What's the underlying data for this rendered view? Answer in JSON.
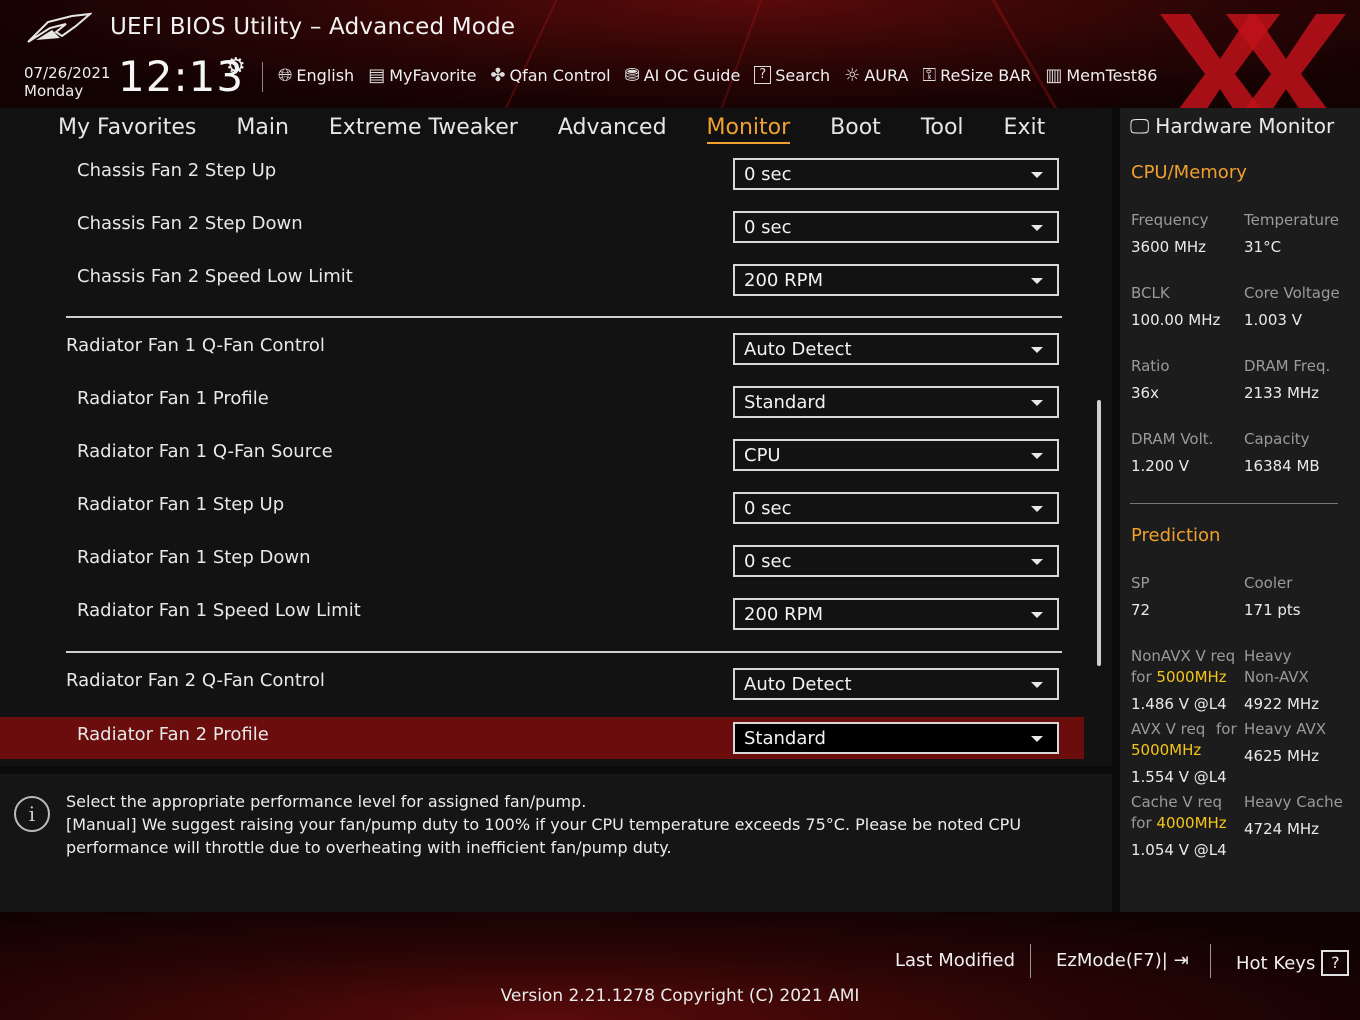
{
  "header": {
    "title": "UEFI BIOS Utility – Advanced Mode",
    "date": "07/26/2021",
    "day": "Monday",
    "time": "12:13",
    "toolbar": [
      {
        "label": "English",
        "icon": "globe-icon"
      },
      {
        "label": "MyFavorite",
        "icon": "favorite-icon"
      },
      {
        "label": "Qfan Control",
        "icon": "fan-icon"
      },
      {
        "label": "AI OC Guide",
        "icon": "ai-chip-icon"
      },
      {
        "label": "Search",
        "icon": "search-icon"
      },
      {
        "label": "AURA",
        "icon": "aura-light-icon"
      },
      {
        "label": "ReSize BAR",
        "icon": "resize-bar-icon"
      },
      {
        "label": "MemTest86",
        "icon": "memory-icon"
      }
    ]
  },
  "nav": {
    "tabs": [
      "My Favorites",
      "Main",
      "Extreme Tweaker",
      "Advanced",
      "Monitor",
      "Boot",
      "Tool",
      "Exit"
    ],
    "active": "Monitor"
  },
  "settings": [
    {
      "label": "Chassis Fan 2 Step Up",
      "value": "0 sec"
    },
    {
      "label": "Chassis Fan 2 Step Down",
      "value": "0 sec"
    },
    {
      "label": "Chassis Fan 2 Speed Low Limit",
      "value": "200 RPM"
    },
    {
      "label": "Radiator Fan 1 Q-Fan Control",
      "value": "Auto Detect"
    },
    {
      "label": "Radiator Fan 1 Profile",
      "value": "Standard"
    },
    {
      "label": "Radiator Fan 1 Q-Fan Source",
      "value": "CPU"
    },
    {
      "label": "Radiator Fan 1 Step Up",
      "value": "0 sec"
    },
    {
      "label": "Radiator Fan 1 Step Down",
      "value": "0 sec"
    },
    {
      "label": "Radiator Fan 1 Speed Low Limit",
      "value": "200 RPM"
    },
    {
      "label": "Radiator Fan 2 Q-Fan Control",
      "value": "Auto Detect"
    },
    {
      "label": "Radiator Fan 2 Profile",
      "value": "Standard",
      "selected": true
    }
  ],
  "help": {
    "lines": [
      "Select the appropriate performance level for assigned fan/pump.",
      "[Manual] We suggest raising your fan/pump duty to 100% if your CPU temperature exceeds 75°C. Please be noted CPU performance will throttle due to overheating with inefficient fan/pump duty."
    ]
  },
  "monitor": {
    "title": "Hardware Monitor",
    "cpu_section": "CPU/Memory",
    "cpu": [
      {
        "label": "Frequency",
        "value": "3600 MHz"
      },
      {
        "label": "Temperature",
        "value": "31°C"
      },
      {
        "label": "BCLK",
        "value": "100.00 MHz"
      },
      {
        "label": "Core Voltage",
        "value": "1.003 V"
      },
      {
        "label": "Ratio",
        "value": "36x"
      },
      {
        "label": "DRAM Freq.",
        "value": "2133 MHz"
      },
      {
        "label": "DRAM Volt.",
        "value": "1.200 V"
      },
      {
        "label": "Capacity",
        "value": "16384 MB"
      }
    ],
    "prediction_section": "Prediction",
    "sp_label": "SP",
    "sp_value": "72",
    "cooler_label": "Cooler",
    "cooler_value": "171 pts",
    "nonavx_label": "NonAVX V req",
    "nonavx_for": "for",
    "nonavx_freq": "5000MHz",
    "nonavx_value": "1.486 V @L4",
    "heavy_nonavx_label1": "Heavy",
    "heavy_nonavx_label2": "Non-AVX",
    "heavy_nonavx_value": "4922 MHz",
    "avx_label": "AVX V req",
    "avx_for": "for",
    "avx_freq": "5000MHz",
    "avx_value": "1.554 V @L4",
    "heavy_avx_label": "Heavy AVX",
    "heavy_avx_value": "4625 MHz",
    "cache_label": "Cache V req",
    "cache_for": "for",
    "cache_freq": "4000MHz",
    "cache_value": "1.054 V @L4",
    "heavy_cache_label": "Heavy Cache",
    "heavy_cache_value": "4724 MHz"
  },
  "footer": {
    "last_modified": "Last Modified",
    "ezmode": "EzMode(F7)|",
    "hotkeys": "Hot Keys",
    "hotkeys_key": "?",
    "version": "Version 2.21.1278 Copyright (C) 2021 AMI"
  },
  "colors": {
    "accent": "#f0a030",
    "highlight": "#f5c518",
    "selected_row": "#6b0d0d",
    "brand_red": "#c0121a"
  }
}
